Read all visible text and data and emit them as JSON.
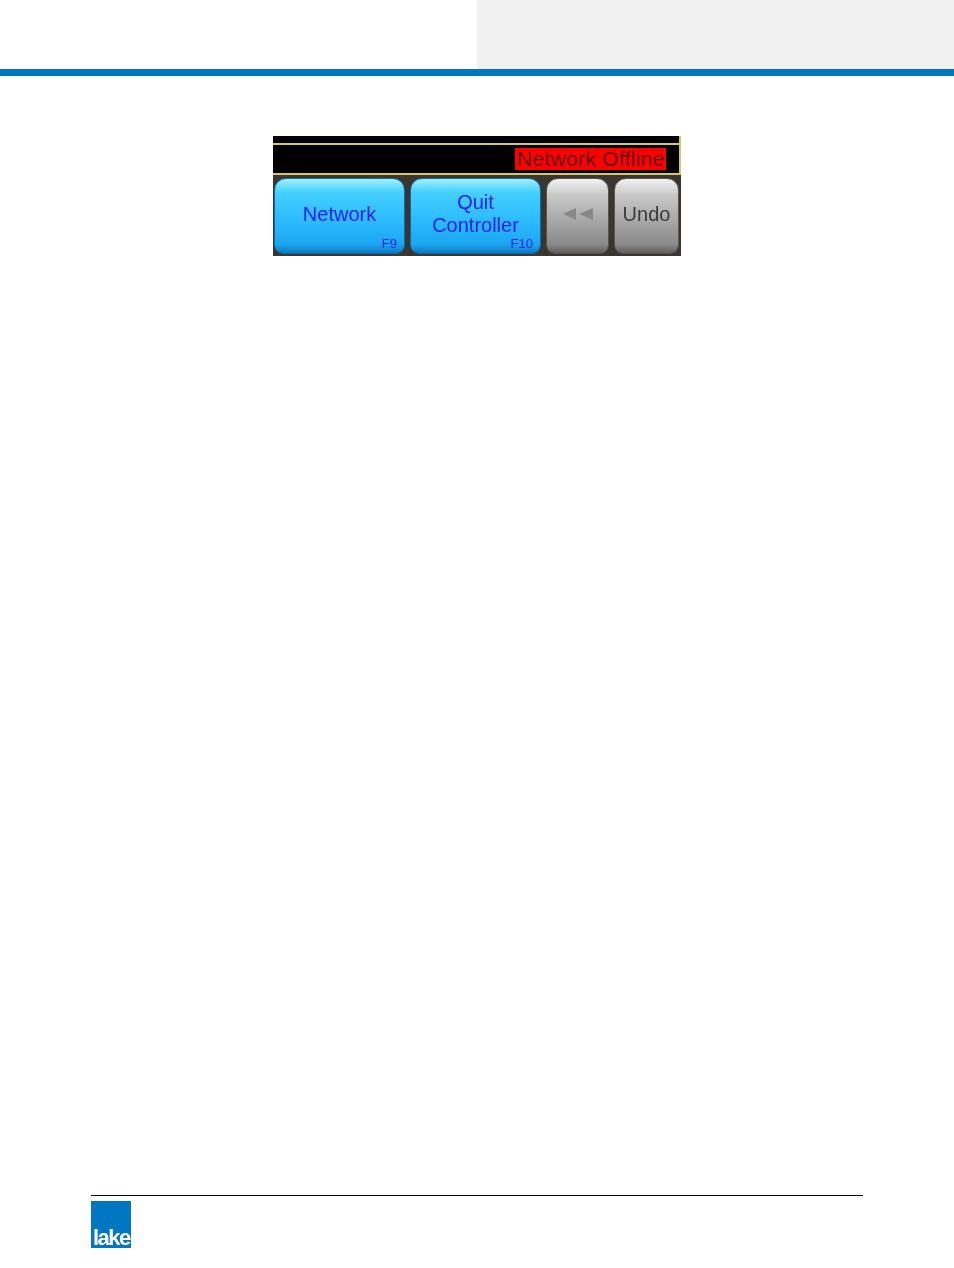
{
  "toolbar": {
    "status": {
      "text": "Network Offline"
    },
    "buttons": [
      {
        "kind": "text",
        "label": "Network",
        "key": "F9",
        "disabled": false
      },
      {
        "kind": "text",
        "label": "Quit Controller",
        "key": "F10",
        "disabled": false
      },
      {
        "kind": "icon",
        "disabled": true
      },
      {
        "kind": "text",
        "label": "Undo",
        "disabled": true
      }
    ]
  },
  "footer": {
    "logo": "lake"
  }
}
